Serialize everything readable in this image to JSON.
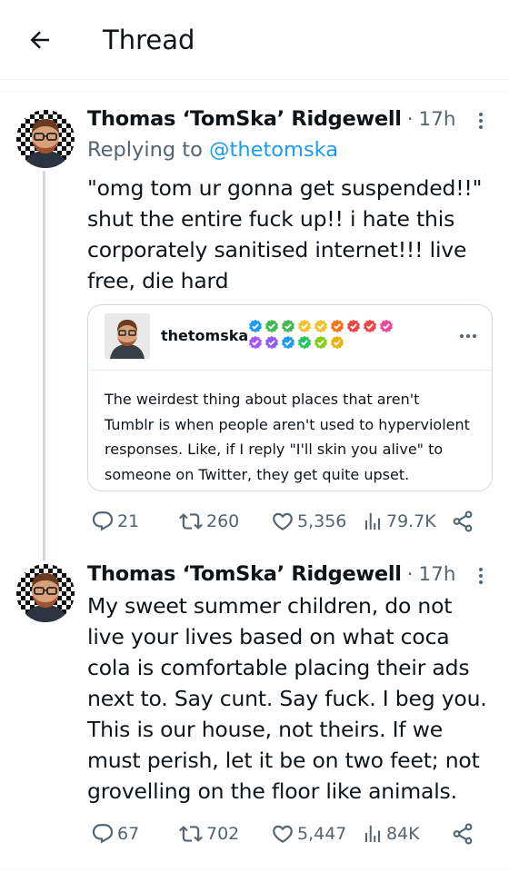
{
  "header": {
    "title": "Thread"
  },
  "tweets": [
    {
      "author": "Thomas ‘TomSka’ Ridgewell",
      "separator": "·",
      "time": "17h",
      "replying_prefix": "Replying to ",
      "replying_handle": "@thetomska",
      "text": "\"omg tom ur gonna get suspended!!\"\nshut the entire fuck up!! i hate this\ncorporately sanitised internet!!! live\nfree, die hard",
      "quote": {
        "username": "thetomska",
        "badge_icons": [
          "verified-check-icon"
        ],
        "text": "The weirdest thing about places that aren't\nTumblr is when people aren't used to hyperviolent\nresponses. Like, if I reply \"I'll skin you alive\" to\nsomeone on Twitter, they get quite upset."
      },
      "stats": {
        "replies": "21",
        "retweets": "260",
        "likes": "5,356",
        "views": "79.7K"
      }
    },
    {
      "author": "Thomas ‘TomSka’ Ridgewell",
      "separator": "·",
      "time": "17h",
      "text": "My sweet summer children, do not\nlive your lives based on what coca\ncola is comfortable placing their ads\nnext to. Say cunt. Say fuck. I beg you.\nThis is our house, not theirs. If we\nmust perish, let it be on two feet; not\ngrovelling on the floor like animals.",
      "stats": {
        "replies": "67",
        "retweets": "702",
        "likes": "5,447",
        "views": "84K"
      }
    }
  ],
  "colors": {
    "accent": "#1d9bf0",
    "secondary_text": "#536471",
    "border": "#cfd9de",
    "badges_row1": [
      "#1d9bf0",
      "#3fb950",
      "#3fb950",
      "#f2c12e",
      "#f2c12e",
      "#f97316",
      "#ef4444",
      "#ef4444",
      "#ec4899"
    ],
    "badges_row2": [
      "#a855f7",
      "#8b5cf6",
      "#1d9bf0",
      "#22c55e",
      "#84cc16",
      "#eab308"
    ]
  },
  "icons": [
    "back-arrow-icon",
    "more-icon",
    "reply-icon",
    "retweet-icon",
    "like-icon",
    "views-icon",
    "share-icon",
    "verified-check-icon"
  ]
}
